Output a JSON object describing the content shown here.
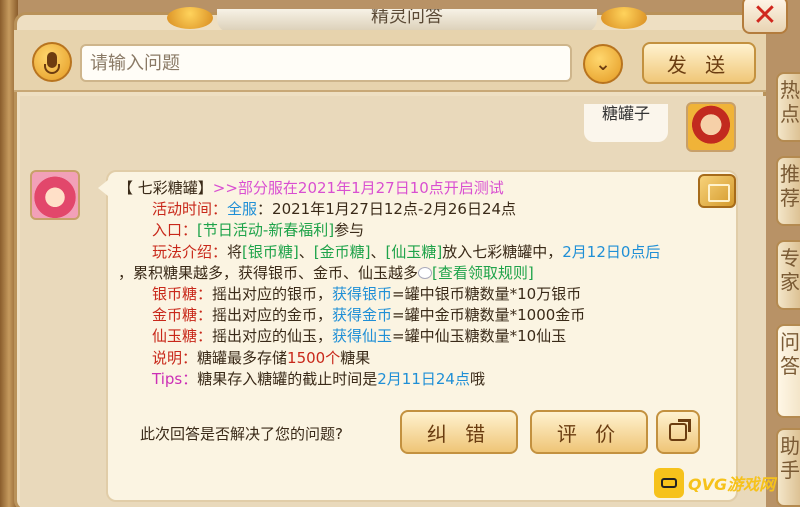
{
  "window": {
    "title": "精灵问答",
    "close_glyph": "✕"
  },
  "input": {
    "placeholder": "请输入问题",
    "send_label": "发 送",
    "dropdown_glyph": "⌄"
  },
  "side_tabs": [
    {
      "label": "热点"
    },
    {
      "label": "推荐"
    },
    {
      "label": "专家"
    },
    {
      "label": "问答"
    },
    {
      "label": "助手"
    }
  ],
  "chat": {
    "user_message": "糖罐子",
    "answer": {
      "title": "【 七彩糖罐】",
      "notice": ">>部分服在2021年1月27日10点开启测试",
      "time_label": "活动时间：",
      "server": "全服",
      "time_value": "：2021年1月27日12点-2月26日24点",
      "entry_label": "入口：",
      "entry_value": "[节日活动-新春福利]",
      "entry_suffix": "参与",
      "play_label": "玩法介绍：",
      "play_1": "将",
      "play_silver": "[银币糖]",
      "play_sep_1": "、",
      "play_gold": "[金币糖]",
      "play_sep_2": "、",
      "play_jade": "[仙玉糖]",
      "play_2": "放入七彩糖罐中，",
      "play_date": "2月12日0点后",
      "play_3": "，累积糖果越多，获得银币、金币、仙玉越多",
      "play_rule": "[查看领取规则]",
      "silver_label": "银币糖：",
      "silver_text": "摇出对应的银币，",
      "silver_get": "获得银币",
      "silver_formula": "=罐中银币糖数量*10万银币",
      "gold_label": "金币糖：",
      "gold_text": "摇出对应的金币，",
      "gold_get": "获得金币",
      "gold_formula": "=罐中金币糖数量*1000金币",
      "jade_label": "仙玉糖：",
      "jade_text": "摇出对应的仙玉，",
      "jade_get": "获得仙玉",
      "jade_formula": "=罐中仙玉糖数量*10仙玉",
      "note_label": "说明：",
      "note_1": "糖罐最多存储",
      "note_count": "1500个",
      "note_2": "糖果",
      "tips_label": "Tips：",
      "tips_1": "糖果存入糖罐的截止时间是",
      "tips_date": "2月11日24点",
      "tips_2": "哦"
    }
  },
  "feedback": {
    "question": "此次回答是否解决了您的问题?",
    "correct_label": "纠 错",
    "rate_label": "评 价"
  },
  "watermark": {
    "text": "QVG游戏网"
  },
  "colors": {
    "highlight_red": "#c8281a",
    "link_blue": "#1f8fd6",
    "green": "#1fa34a",
    "pink": "#d94fd1"
  }
}
